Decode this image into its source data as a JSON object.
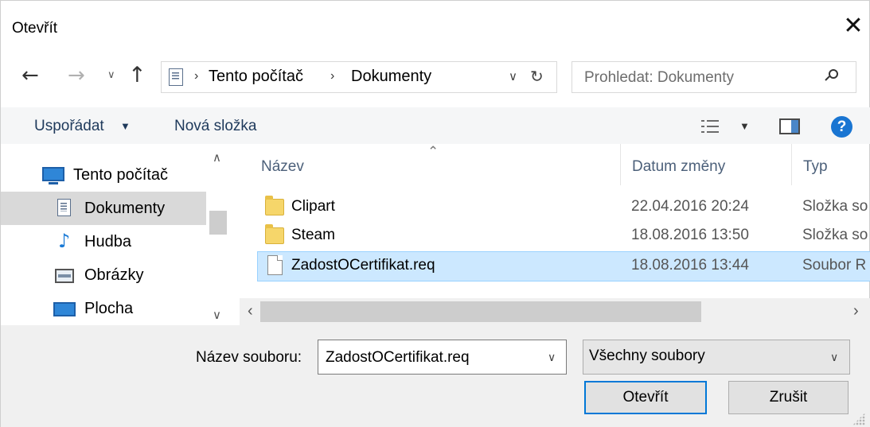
{
  "window": {
    "title": "Otevřít",
    "close_glyph": "✕"
  },
  "nav": {
    "back_glyph": "←",
    "forward_glyph": "→",
    "recent_glyph": "∨",
    "up_glyph": "↑"
  },
  "address": {
    "separator": "›",
    "crumbs": [
      "Tento počítač",
      "Dokumenty"
    ],
    "dropdown_glyph": "∨",
    "refresh_glyph": "↻"
  },
  "search": {
    "placeholder": "Prohledat: Dokumenty"
  },
  "toolbar": {
    "organize_label": "Uspořádat",
    "organize_caret": "▼",
    "new_folder_label": "Nová složka",
    "view_caret": "▼",
    "help_glyph": "?"
  },
  "nav_pane": {
    "items": [
      {
        "label": "Tento počítač",
        "icon": "computer-icon",
        "selected": false
      },
      {
        "label": "Dokumenty",
        "icon": "documents-icon",
        "selected": true
      },
      {
        "label": "Hudba",
        "icon": "music-icon",
        "selected": false
      },
      {
        "label": "Obrázky",
        "icon": "pictures-icon",
        "selected": false
      },
      {
        "label": "Plocha",
        "icon": "desktop-icon",
        "selected": false
      }
    ],
    "scroll_up_glyph": "∧",
    "scroll_down_glyph": "∨"
  },
  "file_list": {
    "sort_glyph": "⌃",
    "columns": {
      "name": "Název",
      "date": "Datum změny",
      "type": "Typ"
    },
    "rows": [
      {
        "name": "Clipart",
        "date": "22.04.2016 20:24",
        "type": "Složka so",
        "icon": "folder-icon",
        "selected": false
      },
      {
        "name": "Steam",
        "date": "18.08.2016 13:50",
        "type": "Složka so",
        "icon": "folder-icon",
        "selected": false
      },
      {
        "name": "ZadostOCertifikat.req",
        "date": "18.08.2016 13:44",
        "type": "Soubor R",
        "icon": "file-icon",
        "selected": true
      }
    ],
    "scroll_left_glyph": "‹",
    "scroll_right_glyph": "›"
  },
  "footer": {
    "filename_label": "Název souboru:",
    "filename_value": "ZadostOCertifikat.req",
    "filter_value": "Všechny soubory",
    "chevron_glyph": "∨",
    "open_label": "Otevřít",
    "cancel_label": "Zrušit"
  },
  "colors": {
    "accent": "#0078d7",
    "selection": "#cce8ff",
    "nav_selection": "#d9d9d9",
    "help": "#1975d2"
  }
}
